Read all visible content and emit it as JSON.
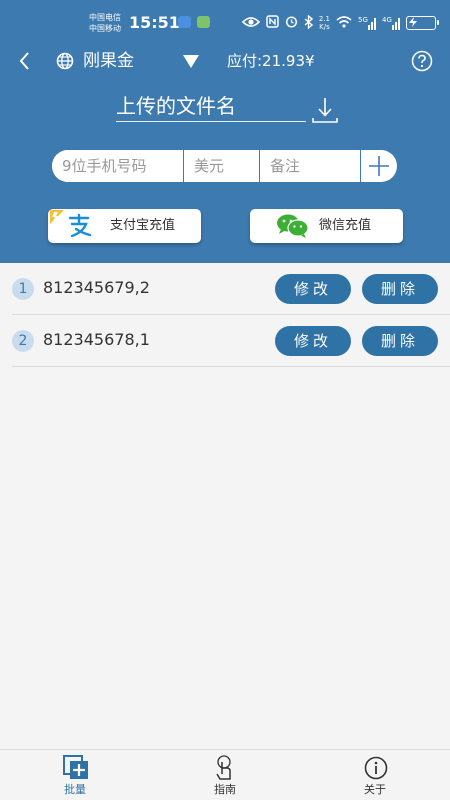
{
  "status_bar": {
    "carrier_1": "中国电信",
    "carrier_2": "中国移动",
    "time": "15:51",
    "net_speed_top": "2.1",
    "net_speed_bottom": "K/s",
    "signal_1": "5G",
    "signal_2": "4G"
  },
  "title_bar": {
    "account_name": "刚果金",
    "payable": "应付:21.93¥"
  },
  "upload": {
    "file_name": "上传的文件名"
  },
  "form": {
    "phone_placeholder": "9位手机号码",
    "amount_placeholder": "美元",
    "note_placeholder": "备注"
  },
  "recharge": {
    "alipay_label": "支付宝充值",
    "wechat_label": "微信充值"
  },
  "list": {
    "items": [
      {
        "index": "1",
        "entry": "812345679,2",
        "edit_label": "修改",
        "delete_label": "删除"
      },
      {
        "index": "2",
        "entry": "812345678,1",
        "edit_label": "修改",
        "delete_label": "删除"
      }
    ]
  },
  "bottom_nav": {
    "items": [
      {
        "label": "批量",
        "icon": "batch-add-icon",
        "active": true
      },
      {
        "label": "指南",
        "icon": "guide-hand-icon",
        "active": false
      },
      {
        "label": "关于",
        "icon": "info-icon",
        "active": false
      }
    ]
  },
  "colors": {
    "primary": "#3d7aaf",
    "button": "#2f72a6",
    "background": "#f4f4f4"
  }
}
